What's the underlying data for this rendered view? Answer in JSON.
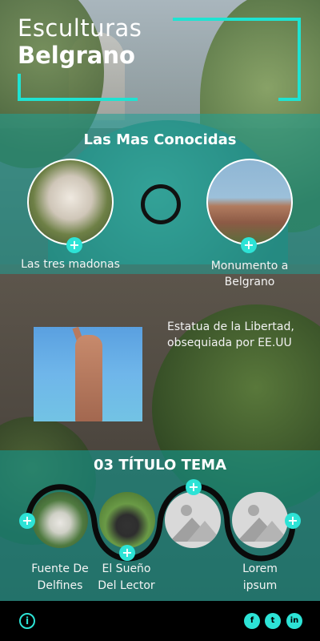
{
  "header": {
    "title_line1": "Esculturas",
    "title_line2": "Belgrano",
    "accent_color": "#1fe3d2"
  },
  "featured": {
    "title": "Las Mas Conocidas",
    "items": [
      {
        "label": "Las tres madonas",
        "icon": "plus-icon"
      },
      {
        "label": "Monumento a Belgrano",
        "icon": "plus-icon"
      }
    ],
    "loader_icon": "ring-loader-icon"
  },
  "statue": {
    "caption": "Estatua de la Libertad, obsequiada por EE.UU"
  },
  "topic": {
    "title": "03 TÍTULO TEMA",
    "items": [
      {
        "label": "Fuente De Delfines",
        "icon": "plus-icon"
      },
      {
        "label": "El Sueño Del Lector",
        "icon": "plus-icon"
      },
      {
        "label": "",
        "icon": "image-placeholder-icon"
      },
      {
        "label": "Lorem ipsum",
        "icon": "image-placeholder-icon"
      }
    ]
  },
  "footer": {
    "info_symbol": "i",
    "social": [
      "f",
      "t",
      "in"
    ],
    "social_icons": [
      "facebook-icon",
      "twitter-icon",
      "linkedin-icon"
    ]
  },
  "colors": {
    "teal_overlay": "#1ea096",
    "cyan": "#2de3d6",
    "footer_bg": "#000000"
  }
}
